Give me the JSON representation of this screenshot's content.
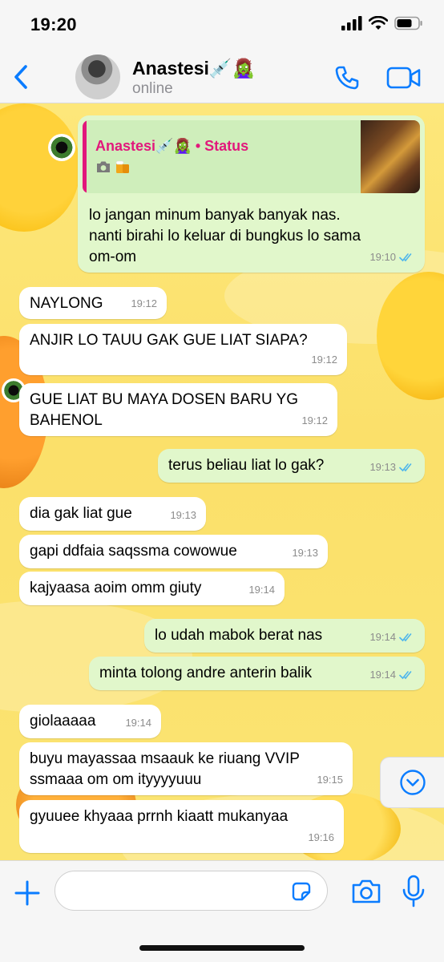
{
  "status_bar": {
    "time": "19:20"
  },
  "header": {
    "contact_name": "Anastesi💉🧟‍♀️",
    "contact_status": "online"
  },
  "colors": {
    "accent": "#0a7cff",
    "quote_author": "#e2187c",
    "outgoing": "#e1f7cb",
    "incoming": "#ffffff",
    "read_ticks": "#4fb6ec"
  },
  "messages": [
    {
      "direction": "out",
      "reply": {
        "author": "Anastesi💉🧟‍♀️ • Status",
        "icons": [
          "camera-icon",
          "beer-icon"
        ]
      },
      "lines": [
        "lo jangan minum banyak banyak nas.",
        "nanti birahi lo keluar di bungkus lo sama",
        "om-om"
      ],
      "time": "19:10",
      "read": true
    },
    {
      "direction": "in",
      "lines": [
        "NAYLONG"
      ],
      "time": "19:12"
    },
    {
      "direction": "in",
      "lines": [
        "ANJIR LO TAUU GAK GUE LIAT SIAPA?"
      ],
      "time": "19:12"
    },
    {
      "direction": "in",
      "lines": [
        "GUE LIAT BU MAYA DOSEN BARU YG",
        "BAHENOL"
      ],
      "time": "19:12"
    },
    {
      "direction": "out",
      "lines": [
        "terus beliau liat lo gak?"
      ],
      "time": "19:13",
      "read": true
    },
    {
      "direction": "in",
      "lines": [
        "dia gak liat gue"
      ],
      "time": "19:13"
    },
    {
      "direction": "in",
      "lines": [
        "gapi ddfaia saqssma cowowue"
      ],
      "time": "19:13"
    },
    {
      "direction": "in",
      "lines": [
        "kajyaasa aoim omm giuty"
      ],
      "time": "19:14"
    },
    {
      "direction": "out",
      "lines": [
        "lo udah mabok berat nas"
      ],
      "time": "19:14",
      "read": true
    },
    {
      "direction": "out",
      "lines": [
        "minta tolong andre anterin balik"
      ],
      "time": "19:14",
      "read": true
    },
    {
      "direction": "in",
      "lines": [
        "giolaaaaa"
      ],
      "time": "19:14"
    },
    {
      "direction": "in",
      "lines": [
        "buyu mayassaa msaauk ke riuang VVIP",
        "ssmaaa om om ityyyyuuu"
      ],
      "time": "19:15"
    },
    {
      "direction": "in",
      "lines": [
        "gyuuee khyaaa prrnh kiaatt mukanyaa"
      ],
      "time": "19:16"
    }
  ],
  "composer": {
    "value": ""
  }
}
